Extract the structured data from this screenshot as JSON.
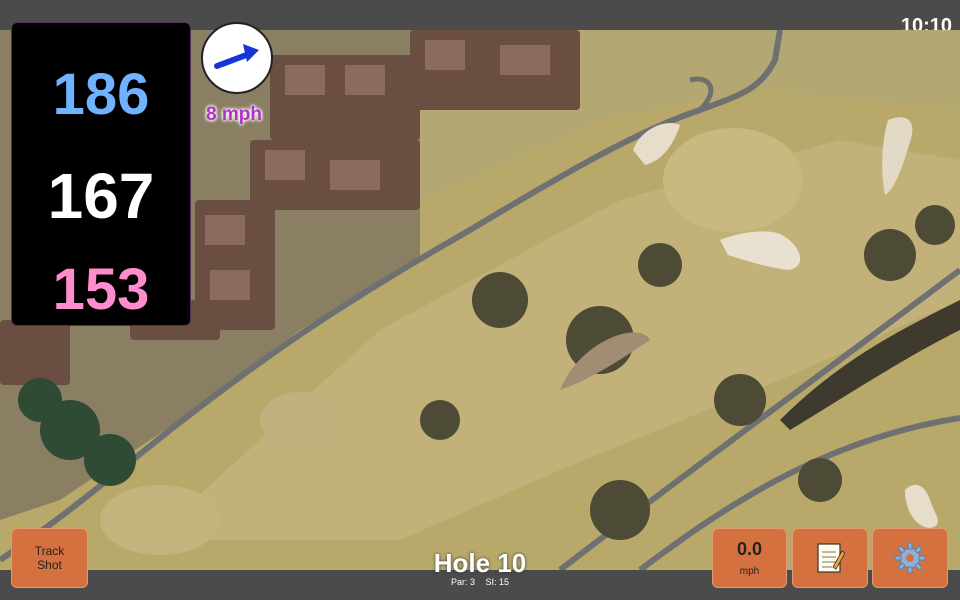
{
  "status_bar": {
    "time": "10:10"
  },
  "distances": {
    "back": "186",
    "middle": "167",
    "front": "153",
    "back_color": "#6fb2ff",
    "middle_color": "#ffffff",
    "front_color": "#ff8ccc"
  },
  "wind": {
    "speed": "8 mph",
    "direction_icon": "arrow-right-icon"
  },
  "buttons": {
    "track_shot_line1": "Track",
    "track_shot_line2": "Shot",
    "speed_value": "0.0",
    "speed_unit": "mph",
    "notes_icon": "notepad-icon",
    "settings_icon": "gear-icon"
  },
  "hole": {
    "title": "Hole 10",
    "par": "Par: 3",
    "si": "SI: 15"
  },
  "colors": {
    "button": "#d4713f",
    "bar": "#4b4b4b",
    "map_grass": "#b9aa6c"
  }
}
